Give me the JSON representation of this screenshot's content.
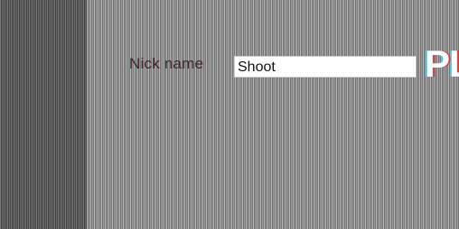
{
  "form": {
    "nick_label": "Nick name",
    "nick_value": "Shoot",
    "play_label": "PL"
  }
}
